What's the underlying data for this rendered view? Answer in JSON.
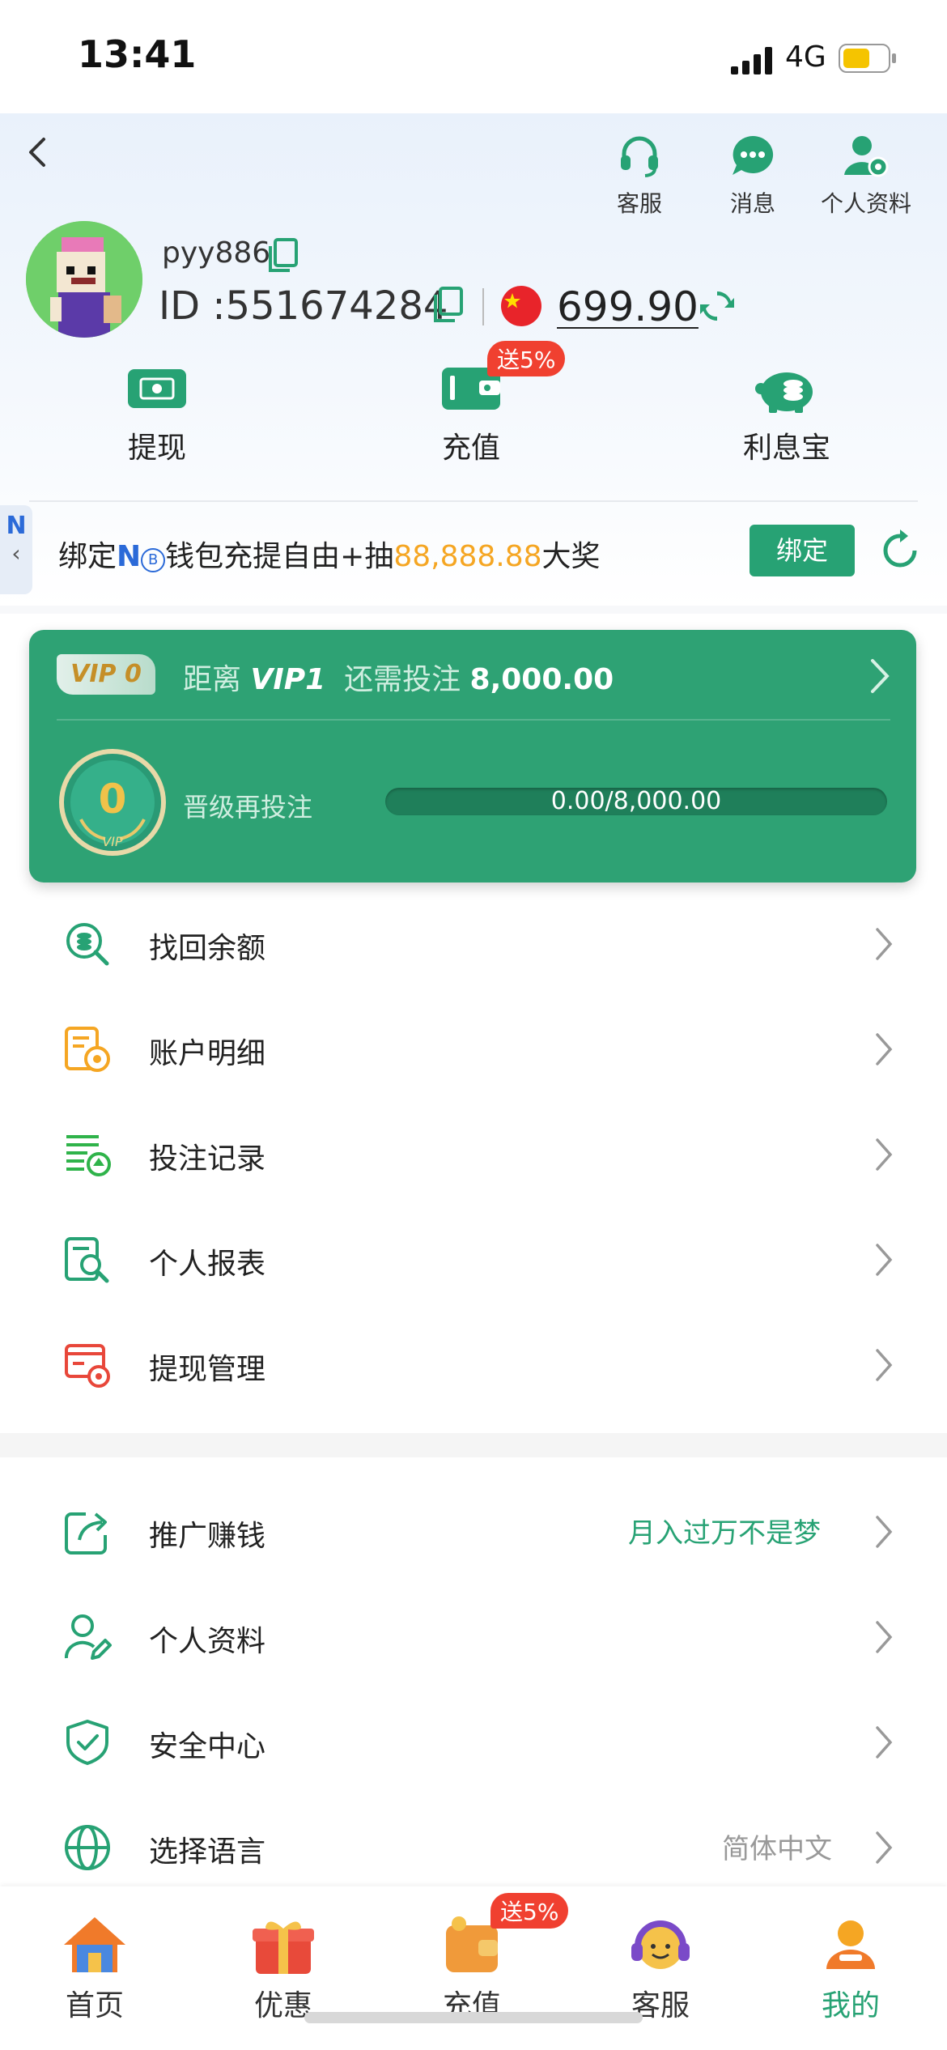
{
  "status_bar": {
    "time": "13:41",
    "network": "4G"
  },
  "header": {
    "actions": [
      {
        "label": "客服",
        "icon": "headset-icon"
      },
      {
        "label": "消息",
        "icon": "chat-bubble-icon"
      },
      {
        "label": "个人资料",
        "icon": "user-gear-icon"
      }
    ]
  },
  "profile": {
    "username": "pyy886",
    "id_label": "ID :",
    "id": "551674284",
    "balance": "699.90",
    "flag": "china-flag-icon"
  },
  "quick_actions": [
    {
      "label": "提现",
      "icon": "cash-icon"
    },
    {
      "label": "充值",
      "icon": "wallet-icon",
      "badge": "送5%"
    },
    {
      "label": "利息宝",
      "icon": "piggy-bank-icon"
    }
  ],
  "bind_banner": {
    "text_pre": "绑定",
    "brand": "N",
    "text_mid": "钱包充提自由+抽",
    "amount": "88,888.88",
    "text_post": "大奖",
    "button": "绑定",
    "side_tab": "N"
  },
  "vip": {
    "tag": "VIP 0",
    "distance_label": "距离",
    "next_level": "VIP1",
    "need_label": "还需投注",
    "need_amount": "8,000.00",
    "medal_level": "0",
    "medal_caption": "VIP",
    "upgrade_label": "晋级再投注",
    "progress_text": "0.00/8,000.00",
    "progress_fraction": 0
  },
  "menu_group1": [
    {
      "label": "找回余额",
      "icon": "coin-search-icon"
    },
    {
      "label": "账户明细",
      "icon": "account-statement-icon"
    },
    {
      "label": "投注记录",
      "icon": "bet-record-icon"
    },
    {
      "label": "个人报表",
      "icon": "report-search-icon"
    },
    {
      "label": "提现管理",
      "icon": "withdraw-settings-icon"
    }
  ],
  "menu_group2": [
    {
      "label": "推广赚钱",
      "icon": "share-icon",
      "extra": "月入过万不是梦"
    },
    {
      "label": "个人资料",
      "icon": "profile-edit-icon",
      "extra": ""
    },
    {
      "label": "安全中心",
      "icon": "shield-check-icon",
      "extra": ""
    },
    {
      "label": "选择语言",
      "icon": "globe-icon",
      "extra": "简体中文"
    }
  ],
  "tabbar": [
    {
      "label": "首页",
      "icon": "home-icon"
    },
    {
      "label": "优惠",
      "icon": "gift-icon"
    },
    {
      "label": "充值",
      "icon": "wallet-icon",
      "badge": "送5%"
    },
    {
      "label": "客服",
      "icon": "support-avatar-icon"
    },
    {
      "label": "我的",
      "icon": "user-icon",
      "active": true
    }
  ],
  "colors": {
    "accent": "#27a274",
    "badge": "#f04030",
    "highlight": "#f5a623"
  }
}
